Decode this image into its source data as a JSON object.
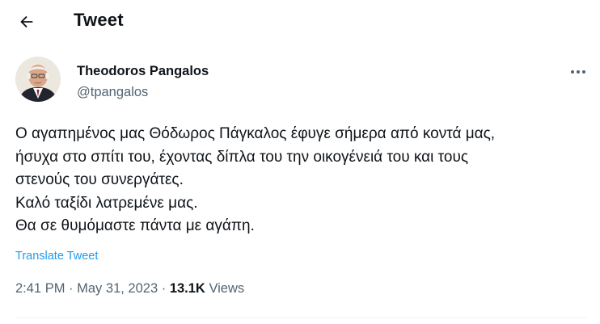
{
  "header": {
    "title": "Tweet",
    "back_icon": "arrow-left-icon"
  },
  "author": {
    "display_name": "Theodoros Pangalos",
    "handle": "@tpangalos",
    "avatar_icon": "user-photo"
  },
  "more_icon": "ellipsis-icon",
  "tweet": {
    "lines": [
      "Ο αγαπημένος μας Θόδωρος Πάγκαλος έφυγε σήμερα από κοντά μας,",
      "ήσυχα στο σπίτι του, έχοντας δίπλα του την οικογένειά του και τους",
      "στενούς του συνεργάτες.",
      "Καλό ταξίδι λατρεμένε μας.",
      "Θα σε θυμόμαστε πάντα με αγάπη."
    ],
    "translate_label": "Translate Tweet",
    "time": "2:41 PM",
    "separator": "·",
    "date": "May 31, 2023",
    "views_count": "13.1K",
    "views_label": "Views"
  },
  "colors": {
    "text": "#0f1419",
    "secondary": "#536471",
    "link": "#1d9bf0",
    "divider": "#eff3f4"
  }
}
